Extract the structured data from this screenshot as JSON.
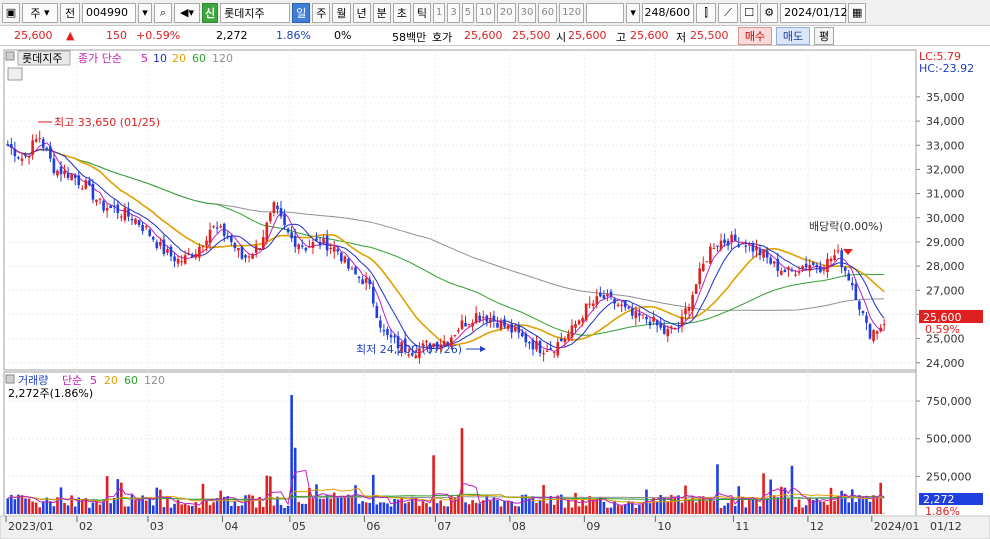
{
  "toolbar": {
    "market": "주",
    "market2": "전",
    "code": "004990",
    "new_badge": "신",
    "name": "롯데지주",
    "periods": [
      "일",
      "주",
      "월",
      "년",
      "분",
      "초",
      "틱"
    ],
    "active_period": "일",
    "nums": [
      "1",
      "3",
      "5",
      "10",
      "20",
      "30",
      "60",
      "120"
    ],
    "count": "248/600",
    "date": "2024/01/12"
  },
  "quote": {
    "price": "25,600",
    "arrow": "▲",
    "change": "150",
    "change_pct": "+0.59%",
    "volume": "2,272",
    "volume_ratio": "1.86%",
    "zero_pct": "0%",
    "amount": "58백만",
    "ask_label": "호가",
    "ask1": "25,600",
    "ask2": "25,500",
    "open_label": "시",
    "open": "25,600",
    "high_label": "고",
    "high": "25,600",
    "low_label": "저",
    "low": "25,500",
    "buy_label": "매수",
    "sell_label": "매도",
    "eval_label": "평"
  },
  "price_panel": {
    "name": "롯데지주",
    "legend_prefix": "종가 단순",
    "ma": [
      "5",
      "10",
      "20",
      "60",
      "120"
    ],
    "lc": "LC:5.79",
    "hc": "HC:-23.92",
    "yticks": [
      "35,000",
      "34,000",
      "33,000",
      "32,000",
      "31,000",
      "30,000",
      "29,000",
      "28,000",
      "27,000",
      "26,000",
      "25,000",
      "24,000"
    ],
    "max_note": "최고 33,650 (01/25)",
    "min_note": "최저 24,200 (07/26)",
    "dividend_note": "배당락(0.00%)",
    "last_price": "25,600",
    "last_pct": "0.59%"
  },
  "volume_panel": {
    "legend_name": "거래량",
    "legend_prefix": "단순",
    "ma": [
      "5",
      "20",
      "60",
      "120"
    ],
    "current": "2,272주(1.86%)",
    "yticks": [
      "750,000",
      "500,000",
      "250,000"
    ],
    "last_vol": "2,272",
    "last_pct": "1.86%"
  },
  "xaxis": {
    "labels": [
      "2023/01",
      "02",
      "03",
      "04",
      "05",
      "06",
      "07",
      "08",
      "09",
      "10",
      "11",
      "12",
      "2024/01"
    ],
    "right_label": "01/12"
  },
  "colors": {
    "up": "#e02020",
    "down": "#1f3fe0",
    "ma5": "#c020c0",
    "ma10": "#2030c0",
    "ma20": "#e0a000",
    "ma60": "#30a030",
    "ma120": "#909090"
  },
  "chart_data": {
    "type": "candlestick",
    "ylim": [
      23700,
      35700
    ],
    "months": [
      "2023/01",
      "02",
      "03",
      "04",
      "05",
      "06",
      "07",
      "08",
      "09",
      "10",
      "11",
      "12",
      "2024/01"
    ],
    "monthly_close": [
      32100,
      30300,
      28000,
      29600,
      29100,
      28500,
      24700,
      25700,
      25900,
      25800,
      28900,
      28300,
      25600
    ],
    "anchors": [
      33000,
      32400,
      33400,
      32000,
      31800,
      31300,
      30500,
      30300,
      30000,
      29400,
      28600,
      28200,
      28600,
      29600,
      29300,
      28300,
      28800,
      30400,
      29200,
      28800,
      29000,
      28700,
      27700,
      27300,
      25200,
      24700,
      24500,
      24800,
      24900,
      25600,
      26000,
      25800,
      25400,
      25000,
      24600,
      24700,
      25300,
      26300,
      26700,
      26400,
      25900,
      25800,
      25200,
      25600,
      27300,
      28900,
      29100,
      29000,
      28600,
      28000,
      27700,
      28100,
      28000,
      28500,
      27200,
      25200,
      25600
    ],
    "max": {
      "value": 33650,
      "date": "01/25"
    },
    "min": {
      "value": 24200,
      "date": "07/26"
    }
  }
}
